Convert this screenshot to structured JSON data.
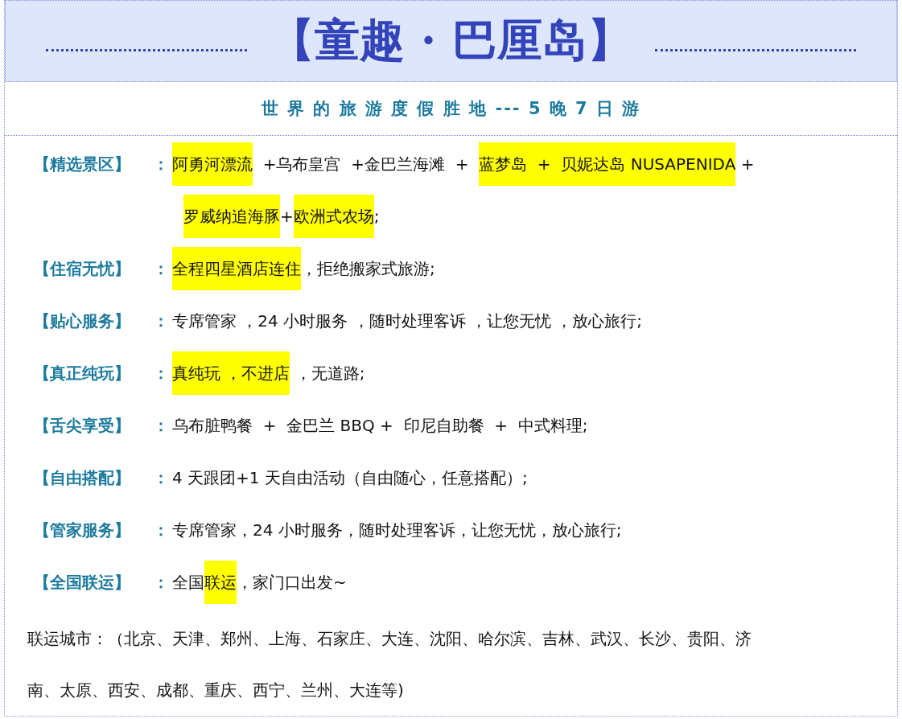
{
  "header": {
    "title": "【童趣 · 巴厘岛】",
    "subtitle": "世 界 的 旅 游 度 假 胜 地 --- 5 晚 7 日 游"
  },
  "rows": [
    {
      "label": "【精选景区】",
      "colon": "：",
      "lines": [
        [
          {
            "text": "阿勇河漂流",
            "highlighted": true
          },
          {
            "text": "  +乌布皇宫  +金巴兰海滩  +  ",
            "highlighted": false
          },
          {
            "text": "蓝梦岛  +  贝妮达岛 NUSAPENIDA",
            "highlighted": true
          },
          {
            "text": " +",
            "highlighted": false
          }
        ],
        [
          {
            "text": "罗威纳追海豚",
            "highlighted": true
          },
          {
            "text": "+",
            "highlighted": false
          },
          {
            "text": "欧洲式农场",
            "highlighted": true
          },
          {
            "text": ";",
            "highlighted": false
          }
        ]
      ]
    },
    {
      "label": "【住宿无忧】",
      "colon": "：",
      "lines": [
        [
          {
            "text": "全程四星酒店连住",
            "highlighted": true
          },
          {
            "text": "，拒绝搬家式旅游;",
            "highlighted": false
          }
        ]
      ]
    },
    {
      "label": "【贴心服务】",
      "colon": "：",
      "lines": [
        [
          {
            "text": "专席管家 ，24 小时服务 ，随时处理客诉 ，让您无忧 ，放心旅行;",
            "highlighted": false
          }
        ]
      ]
    },
    {
      "label": "【真正纯玩】",
      "colon": "：",
      "lines": [
        [
          {
            "text": "真纯玩 ，不进店",
            "highlighted": true
          },
          {
            "text": " ，无道路;",
            "highlighted": false
          }
        ]
      ]
    },
    {
      "label": "【舌尖享受】",
      "colon": "：",
      "lines": [
        [
          {
            "text": "乌布脏鸭餐  +  金巴兰 BBQ +  印尼自助餐  +  中式料理;",
            "highlighted": false
          }
        ]
      ]
    },
    {
      "label": "【自由搭配】",
      "colon": "：",
      "lines": [
        [
          {
            "text": "4 天跟团+1 天自由活动（自由随心，任意搭配）;",
            "highlighted": false
          }
        ]
      ]
    },
    {
      "label": "【管家服务】",
      "colon": "：",
      "lines": [
        [
          {
            "text": "专席管家，24 小时服务，随时处理客诉，让您无忧，放心旅行;",
            "highlighted": false
          }
        ]
      ]
    },
    {
      "label": "【全国联运】",
      "colon": "：",
      "lines": [
        [
          {
            "text": "全国",
            "highlighted": false
          },
          {
            "text": "联运",
            "highlighted": true
          },
          {
            "text": "，家门口出发~",
            "highlighted": false
          }
        ]
      ]
    }
  ],
  "note": {
    "lines": [
      "联运城市：（北京、天津、郑州、上海、石家庄、大连、沈阳、哈尔滨、吉林、武汉、长沙、贵阳、济",
      "南、太原、西安、成都、重庆、西宁、兰州、大连等)"
    ]
  }
}
